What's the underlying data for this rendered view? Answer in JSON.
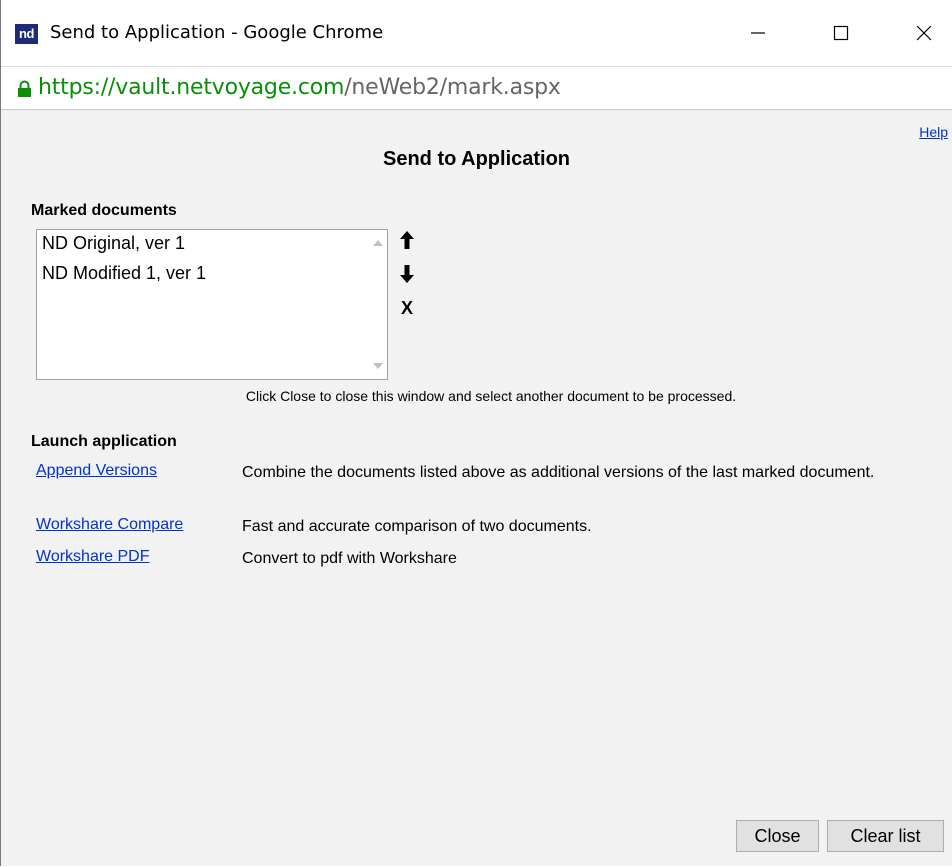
{
  "window": {
    "logo_text": "nd",
    "title": "Send to Application - Google Chrome"
  },
  "address": {
    "scheme": "https://",
    "host": "vault.netvoyage.com",
    "path": "/neWeb2/mark.aspx"
  },
  "page": {
    "help_label": "Help",
    "title": "Send to Application",
    "marked_label": "Marked documents",
    "marked_documents": [
      "ND Original, ver 1",
      "ND Modified 1, ver 1"
    ],
    "remove_label": "X",
    "hint": "Click Close to close this window and select another document to be processed.",
    "launch_label": "Launch application",
    "applications": [
      {
        "name": "Append Versions",
        "description": "Combine the documents listed above as additional versions of the last marked document."
      },
      {
        "name": "Workshare Compare",
        "description": "Fast and accurate comparison of two documents."
      },
      {
        "name": "Workshare PDF",
        "description": "Convert to pdf with Workshare"
      }
    ],
    "close_label": "Close",
    "clear_label": "Clear list"
  },
  "colors": {
    "link": "#0033cc",
    "secure_green": "#0a8f08",
    "logo_bg": "#1c2a78"
  }
}
